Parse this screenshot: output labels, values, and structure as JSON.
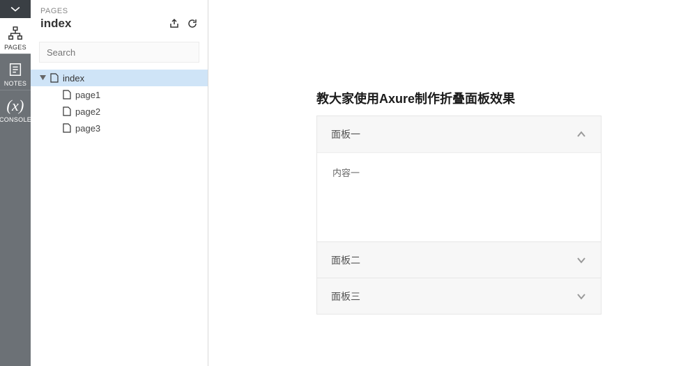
{
  "rail": {
    "items": [
      {
        "label": "PAGES",
        "key": "pages",
        "active": true
      },
      {
        "label": "NOTES",
        "key": "notes",
        "active": false
      },
      {
        "label": "CONSOLE",
        "key": "console",
        "active": false
      }
    ]
  },
  "panel": {
    "header_label": "PAGES",
    "current_page": "index",
    "search_placeholder": "Search"
  },
  "tree": {
    "root": {
      "label": "index",
      "expanded": true,
      "selected": true
    },
    "children": [
      {
        "label": "page1"
      },
      {
        "label": "page2"
      },
      {
        "label": "page3"
      }
    ]
  },
  "preview": {
    "title": "教大家使用Axure制作折叠面板效果",
    "accordion": [
      {
        "header": "面板一",
        "expanded": true,
        "content": "内容一"
      },
      {
        "header": "面板二",
        "expanded": false,
        "content": ""
      },
      {
        "header": "面板三",
        "expanded": false,
        "content": ""
      }
    ]
  }
}
